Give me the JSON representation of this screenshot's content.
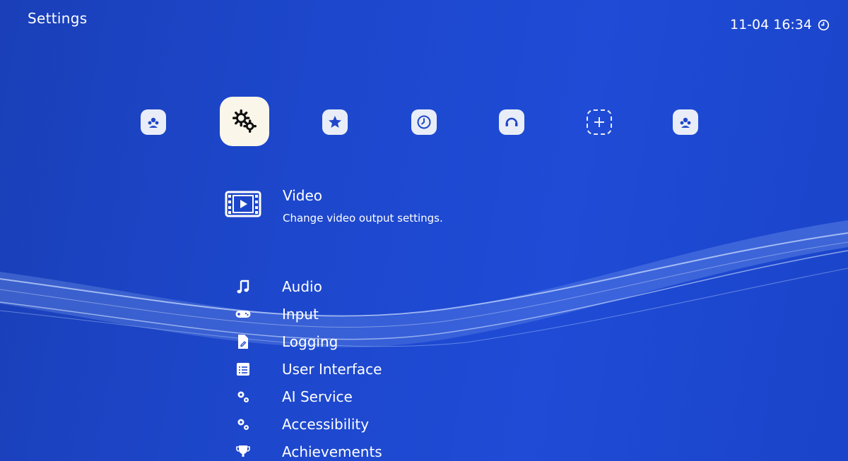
{
  "header": {
    "title": "Settings",
    "clock": "11-04 16:34",
    "clock_icon": "clock-icon"
  },
  "categories": [
    {
      "name": "netplay-icon",
      "selected": false
    },
    {
      "name": "settings-gears-icon",
      "selected": true
    },
    {
      "name": "favorites-star-icon",
      "selected": false
    },
    {
      "name": "history-clock-icon",
      "selected": false
    },
    {
      "name": "online-updater-icon",
      "selected": false
    },
    {
      "name": "add-content-icon",
      "selected": false
    },
    {
      "name": "netplay-icon",
      "selected": false
    }
  ],
  "selected_item": {
    "label": "Video",
    "description": "Change video output settings.",
    "icon": "video-icon"
  },
  "menu": {
    "items": [
      {
        "label": "Audio",
        "icon": "music-note-icon"
      },
      {
        "label": "Input",
        "icon": "gamepad-icon"
      },
      {
        "label": "Logging",
        "icon": "file-edit-icon"
      },
      {
        "label": "User Interface",
        "icon": "list-window-icon"
      },
      {
        "label": "AI Service",
        "icon": "gears-icon"
      },
      {
        "label": "Accessibility",
        "icon": "gears-icon"
      },
      {
        "label": "Achievements",
        "icon": "trophy-icon"
      }
    ]
  },
  "colors": {
    "background": "#1f4bd6",
    "icon_tile": "#e9edf7",
    "selected_tile": "#fbf6ea",
    "icon_glyph": "#1f47c9"
  }
}
